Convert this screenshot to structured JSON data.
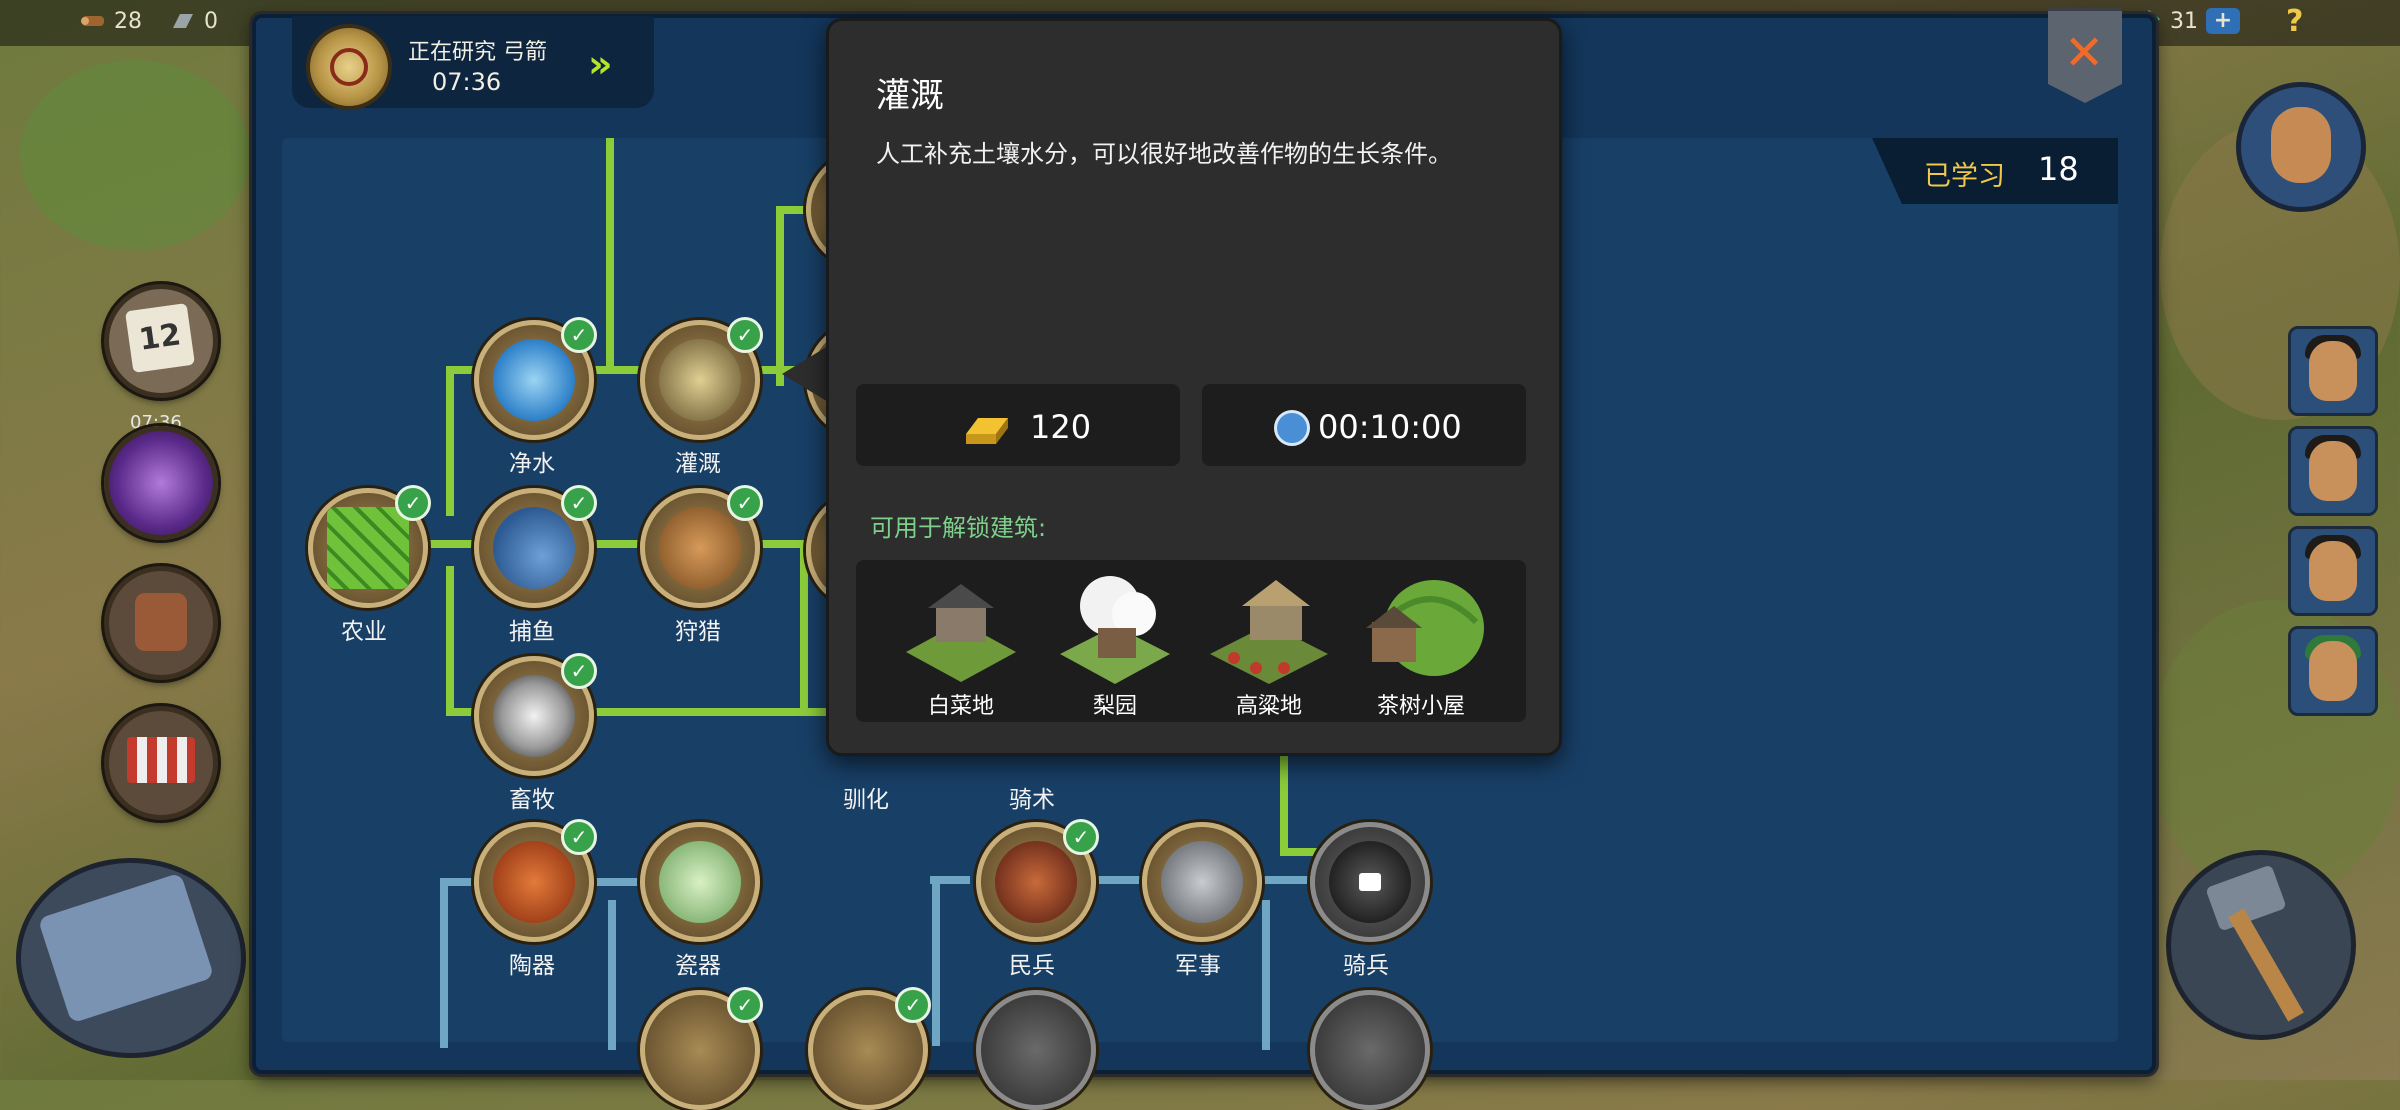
{
  "topbar": {
    "resources": [
      {
        "icon": "wood-icon",
        "value": "28"
      },
      {
        "icon": "iron-icon",
        "value": "0"
      }
    ],
    "currency": {
      "icon": "gem-icon",
      "value": "31",
      "add_label": "+"
    },
    "help_label": "?"
  },
  "left_sidebar": {
    "calendar_day": "12",
    "calendar_timer": "07:36"
  },
  "research": {
    "status_label": "正在研究 弓箭",
    "timer": "07:36",
    "speed_up_icon": "fast-forward-icon"
  },
  "learned": {
    "label": "已学习",
    "count": "18"
  },
  "tech_nodes": [
    {
      "key": "water",
      "label": "净水",
      "icon": "water-drops-icon",
      "done": true
    },
    {
      "key": "irrigation",
      "label": "灌溉",
      "icon": "irrigation-icon",
      "done": true
    },
    {
      "key": "agriculture",
      "label": "农业",
      "icon": "farm-field-icon",
      "done": true
    },
    {
      "key": "fishing",
      "label": "捕鱼",
      "icon": "fish-icon",
      "done": true
    },
    {
      "key": "hunting",
      "label": "狩猎",
      "icon": "deer-icon",
      "done": true
    },
    {
      "key": "herding",
      "label": "畜牧",
      "icon": "cow-icon",
      "done": true
    },
    {
      "key": "domestication",
      "label": "驯化",
      "icon": "domestication-icon",
      "done": false
    },
    {
      "key": "horsemanship",
      "label": "骑术",
      "icon": "horsemanship-icon",
      "done": false
    },
    {
      "key": "pottery",
      "label": "陶器",
      "icon": "pottery-icon",
      "done": true
    },
    {
      "key": "porcelain",
      "label": "瓷器",
      "icon": "porcelain-icon",
      "done": false
    },
    {
      "key": "militia",
      "label": "民兵",
      "icon": "militia-icon",
      "done": true
    },
    {
      "key": "military",
      "label": "军事",
      "icon": "crossed-swords-icon",
      "done": false
    },
    {
      "key": "cavalry",
      "label": "骑兵",
      "icon": "cavalry-icon",
      "done": false,
      "locked": true
    }
  ],
  "tooltip": {
    "title": "灌溉",
    "description": "人工补充土壤水分，可以很好地改善作物的生长条件。",
    "cost_gold": "120",
    "cost_time": "00:10:00",
    "unlock_label": "可用于解锁建筑:",
    "buildings": [
      {
        "label": "白菜地",
        "icon": "cabbage-field-icon"
      },
      {
        "label": "梨园",
        "icon": "pear-orchard-icon"
      },
      {
        "label": "高粱地",
        "icon": "sorghum-field-icon"
      },
      {
        "label": "茶树小屋",
        "icon": "tea-house-icon"
      }
    ]
  },
  "colors": {
    "panel_bg": "#13365a",
    "tree_line_done": "#8ccc3a",
    "tree_line_pending": "#6ea6c4",
    "learned_label": "#f0c84a",
    "unlock_label": "#7ed18a",
    "check_green": "#37a24a"
  }
}
